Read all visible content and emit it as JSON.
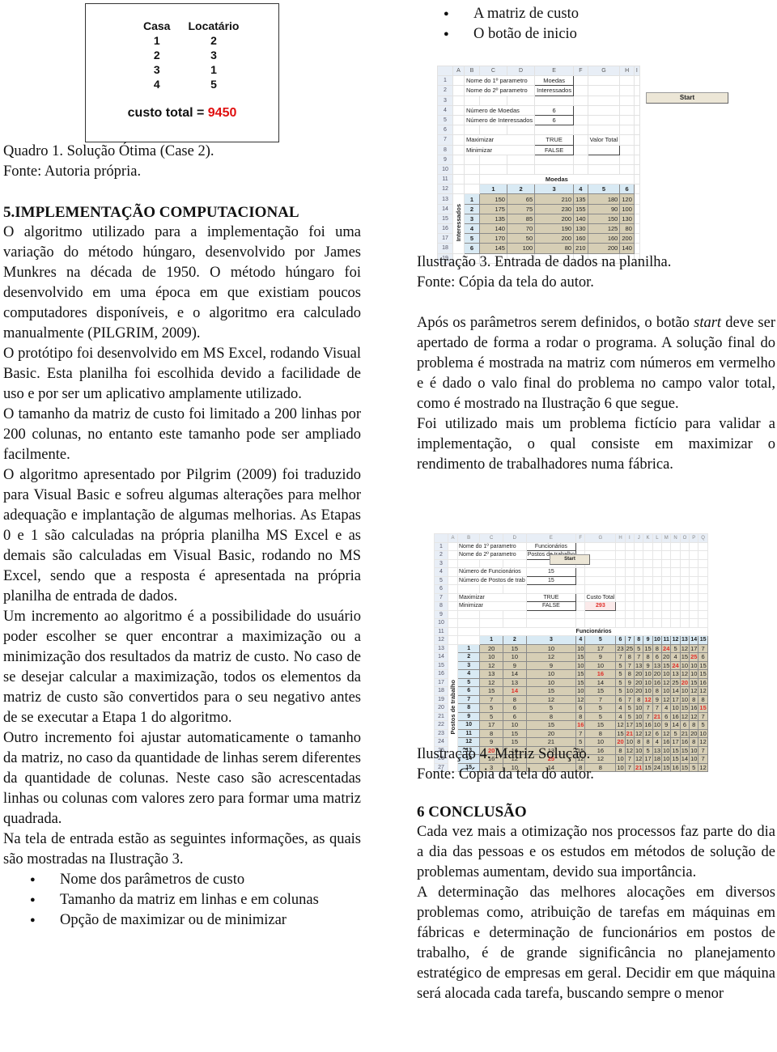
{
  "quadro1": {
    "headers": [
      "Casa",
      "Locatário"
    ],
    "rows": [
      [
        "1",
        "2"
      ],
      [
        "2",
        "3"
      ],
      [
        "3",
        "1"
      ],
      [
        "4",
        "5"
      ]
    ],
    "total_label": "custo total = ",
    "total_value": "9450",
    "caption": "Quadro 1. Solução Ótima (Case 2).",
    "source": "Fonte: Autoria própria."
  },
  "left": {
    "section_title": "5.IMPLEMENTAÇÃO COMPUTACIONAL",
    "paragraphs": [
      "O algoritmo utilizado para a implementação foi uma variação do método húngaro, desenvolvido por James Munkres na década de 1950. O método húngaro foi desenvolvido em uma época em que existiam poucos computadores disponíveis, e o algoritmo era calculado manualmente (PILGRIM, 2009).",
      "O protótipo foi desenvolvido em MS Excel, rodando Visual Basic. Esta planilha foi escolhida devido a facilidade de uso e por ser um aplicativo amplamente utilizado.",
      "O tamanho da matriz de custo foi limitado a 200 linhas por 200 colunas, no entanto este tamanho pode ser ampliado facilmente.",
      "O algoritmo apresentado por Pilgrim (2009) foi traduzido para Visual Basic e sofreu algumas alterações para melhor adequação e implantação de algumas melhorias. As Etapas 0 e 1 são calculadas na própria planilha MS Excel e as demais são calculadas em Visual Basic, rodando no MS Excel, sendo que a resposta é apresentada na própria planilha de entrada de dados.",
      "Um incremento ao algoritmo é a possibilidade do usuário poder escolher se quer encontrar a maximização ou a minimização dos resultados da matriz de custo. No caso de se desejar calcular a maximização, todos os elementos da matriz de custo são convertidos para o seu negativo antes de se executar a Etapa 1 do algoritmo.",
      "Outro incremento foi ajustar automaticamente o tamanho da matriz, no caso da quantidade de linhas serem diferentes da quantidade de colunas. Neste caso são acrescentadas linhas ou colunas com valores zero para formar uma matriz quadrada.",
      "Na tela de entrada estão as seguintes informações, as quais são mostradas na Ilustração 3."
    ],
    "bullets": [
      "Nome dos parâmetros de custo",
      "Tamanho da matriz em linhas e em colunas",
      "Opção de maximizar ou de minimizar"
    ]
  },
  "right": {
    "bullets_top": [
      "A matriz de custo",
      "O botão de inicio"
    ],
    "ilustracao3_caption": "Ilustração 3. Entrada de dados na planilha.",
    "ilustracao3_source": "Fonte: Cópia da tela do autor.",
    "para_start_before": "Após os parâmetros serem definidos, o botão ",
    "para_start_italic": "start",
    "para_start_after": " deve ser apertado de forma a rodar o programa. A solução final do problema é mostrada na matriz com números em vermelho e é dado o valo final do problema no campo valor total, como é mostrado na Ilustração 6 que segue.",
    "para_ficticio": "Foi utilizado mais um problema fictício para validar a implementação, o qual consiste em maximizar o rendimento de trabalhadores numa fábrica.",
    "ilustracao4_caption": "Ilustração 4. Matriz Solução.",
    "ilustracao4_source": "Fonte: Cópia da tela do autor.",
    "conclusion_title": "6 CONCLUSÃO",
    "conclusion_paragraphs": [
      "Cada vez mais a otimização nos processos faz parte do dia a dia das pessoas e os estudos em métodos de solução de problemas aumentam, devido sua importância.",
      "A determinação das melhores alocações em diversos problemas como, atribuição de tarefas em máquinas em fábricas e determinação de funcionários em postos de trabalho, é de grande significância no planejamento estratégico de empresas em geral. Decidir em que máquina será alocada cada tarefa, buscando sempre o menor"
    ]
  },
  "sheet1": {
    "col_headers": [
      "A",
      "B",
      "C",
      "D",
      "E",
      "F",
      "G",
      "H",
      "I"
    ],
    "param1_label": "Nome do 1º parametro",
    "param1_value": "Moedas",
    "param2_label": "Nome do 2º parametro",
    "param2_value": "Interessados",
    "count1_label": "Número de Moedas",
    "count1_value": "6",
    "count2_label": "Número de Interessados",
    "count2_value": "6",
    "max_label": "Maximizar",
    "max_value": "TRUE",
    "min_label": "Minimizar",
    "min_value": "FALSE",
    "start_label": "Start",
    "total_label": "Valor Total",
    "total_value": "",
    "matrix_col_title": "Moedas",
    "matrix_row_title": "Interessados",
    "matrix_cols": [
      "1",
      "2",
      "3",
      "4",
      "5",
      "6"
    ],
    "matrix_rows": [
      {
        "id": "1",
        "values": [
          150,
          65,
          210,
          135,
          180,
          120
        ]
      },
      {
        "id": "2",
        "values": [
          175,
          75,
          230,
          155,
          90,
          100
        ]
      },
      {
        "id": "3",
        "values": [
          135,
          85,
          200,
          140,
          150,
          130
        ]
      },
      {
        "id": "4",
        "values": [
          140,
          70,
          190,
          130,
          125,
          80
        ]
      },
      {
        "id": "5",
        "values": [
          170,
          50,
          200,
          160,
          160,
          200
        ]
      },
      {
        "id": "6",
        "values": [
          145,
          100,
          80,
          210,
          200,
          140
        ]
      }
    ]
  },
  "sheet2": {
    "col_headers": [
      "A",
      "B",
      "C",
      "D",
      "E",
      "F",
      "G",
      "H",
      "I",
      "J",
      "K",
      "L",
      "M",
      "N",
      "O",
      "P",
      "Q"
    ],
    "param1_label": "Nome do 1º parametro",
    "param1_value": "Funcionários",
    "param2_label": "Nome do 2º parametro",
    "param2_value": "Postos de trabalho",
    "count1_label": "Número de Funcionários",
    "count1_value": "15",
    "count2_label": "Número de Postos de trab",
    "count2_value": "15",
    "max_label": "Maximizar",
    "max_value": "TRUE",
    "min_label": "Minimizar",
    "min_value": "FALSE",
    "start_label": "Start",
    "total_label": "Custo Total",
    "total_value": "293",
    "matrix_col_title": "Funcionários",
    "matrix_row_title": "Postos de trabalho",
    "matrix_cols": [
      "1",
      "2",
      "3",
      "4",
      "5",
      "6",
      "7",
      "8",
      "9",
      "10",
      "11",
      "12",
      "13",
      "14",
      "15"
    ],
    "matrix_rows": [
      {
        "id": "1",
        "values": [
          20,
          15,
          10,
          10,
          17,
          23,
          25,
          5,
          15,
          8,
          24,
          5,
          12,
          17,
          7
        ],
        "selected": 11
      },
      {
        "id": "2",
        "values": [
          10,
          10,
          12,
          15,
          9,
          7,
          8,
          7,
          8,
          6,
          20,
          4,
          15,
          25,
          6
        ],
        "selected": 14
      },
      {
        "id": "3",
        "values": [
          12,
          9,
          9,
          10,
          10,
          5,
          7,
          13,
          9,
          13,
          15,
          24,
          10,
          10,
          15
        ],
        "selected": 12
      },
      {
        "id": "4",
        "values": [
          13,
          14,
          10,
          15,
          16,
          5,
          8,
          20,
          10,
          20,
          10,
          13,
          12,
          10,
          15
        ],
        "selected": 5
      },
      {
        "id": "5",
        "values": [
          12,
          13,
          10,
          15,
          14,
          5,
          9,
          20,
          10,
          16,
          12,
          25,
          20,
          15,
          16
        ],
        "selected": 13
      },
      {
        "id": "6",
        "values": [
          15,
          14,
          15,
          10,
          15,
          5,
          10,
          20,
          10,
          8,
          10,
          14,
          10,
          12,
          12
        ],
        "selected": 2
      },
      {
        "id": "7",
        "values": [
          7,
          8,
          12,
          12,
          7,
          6,
          7,
          8,
          12,
          9,
          12,
          17,
          10,
          8,
          8
        ],
        "selected": 9
      },
      {
        "id": "8",
        "values": [
          5,
          6,
          5,
          6,
          5,
          4,
          5,
          10,
          7,
          7,
          4,
          10,
          15,
          16,
          15
        ],
        "selected": 15
      },
      {
        "id": "9",
        "values": [
          5,
          6,
          8,
          8,
          5,
          4,
          5,
          10,
          7,
          21,
          6,
          16,
          12,
          12,
          7
        ],
        "selected": 10
      },
      {
        "id": "10",
        "values": [
          17,
          10,
          15,
          16,
          15,
          12,
          17,
          15,
          16,
          10,
          9,
          14,
          6,
          8,
          5
        ],
        "selected": 4
      },
      {
        "id": "11",
        "values": [
          8,
          15,
          20,
          7,
          8,
          15,
          21,
          12,
          12,
          6,
          12,
          5,
          21,
          20,
          10
        ],
        "selected": 7
      },
      {
        "id": "12",
        "values": [
          9,
          15,
          21,
          5,
          10,
          20,
          10,
          8,
          8,
          4,
          16,
          17,
          16,
          8,
          12
        ],
        "selected": 6
      },
      {
        "id": "13",
        "values": [
          20,
          16,
          13,
          15,
          16,
          8,
          12,
          10,
          5,
          13,
          10,
          15,
          15,
          10,
          7
        ],
        "selected": 1
      },
      {
        "id": "14",
        "values": [
          16,
          12,
          25,
          12,
          12,
          10,
          7,
          12,
          17,
          18,
          10,
          15,
          14,
          10,
          7
        ],
        "selected": 3
      },
      {
        "id": "15",
        "values": [
          3,
          10,
          14,
          8,
          8,
          10,
          7,
          21,
          15,
          24,
          15,
          16,
          15,
          5,
          12
        ],
        "selected": 8
      }
    ]
  },
  "colors": {
    "solution_red": "#e0302a",
    "matrix_cell": "#d6ceb5",
    "matrix_header": "#d9eaf4",
    "total_red": "#e01010"
  }
}
